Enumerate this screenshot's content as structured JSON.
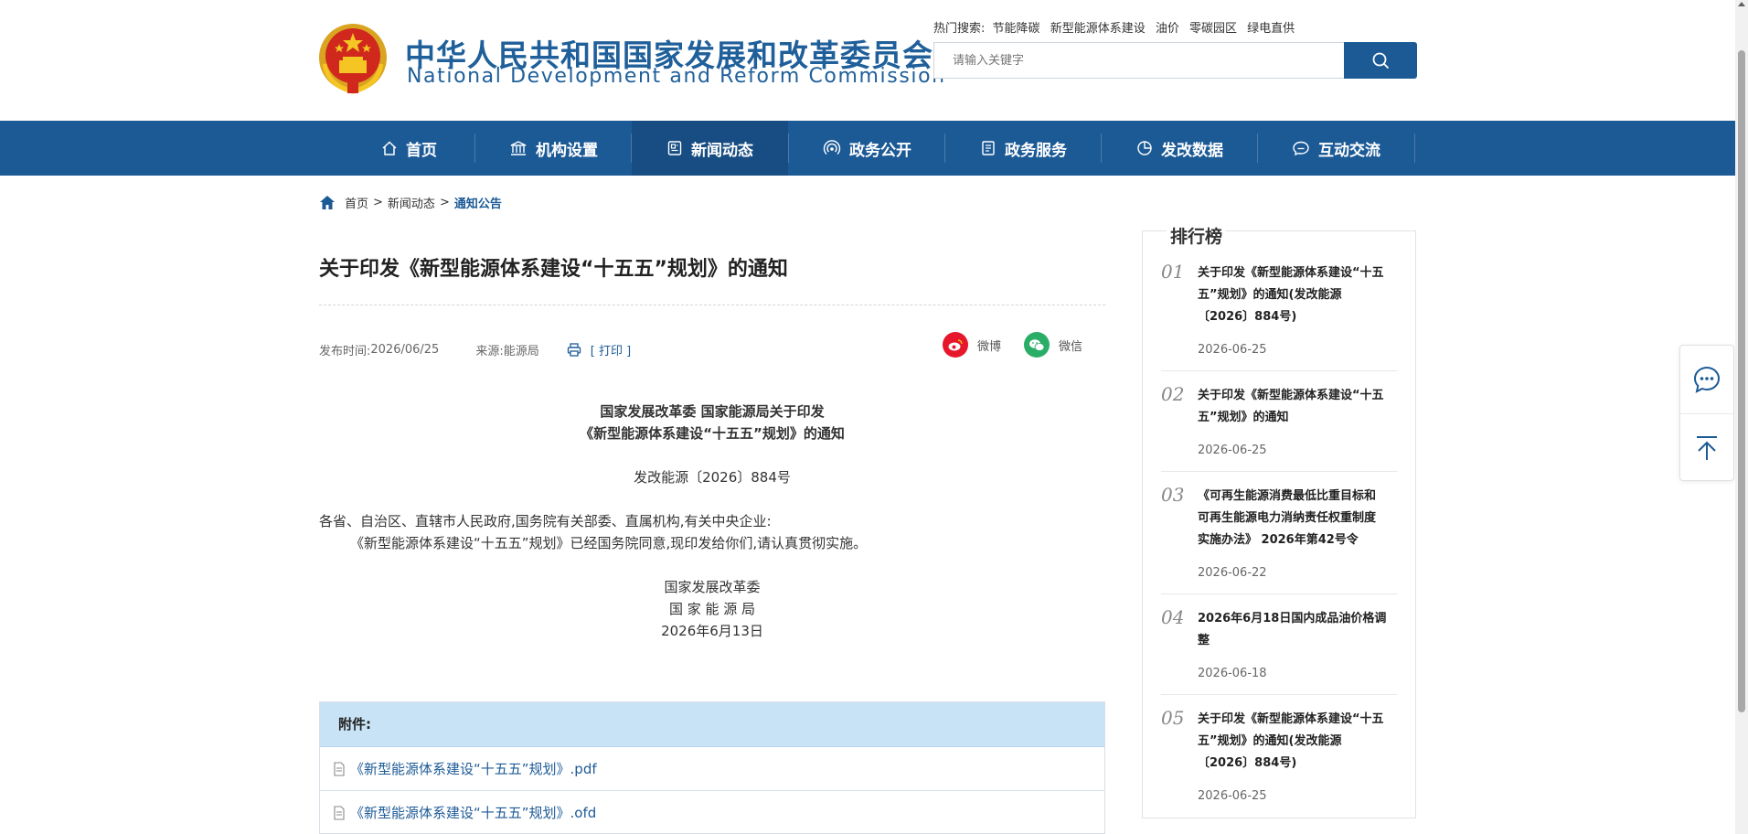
{
  "header": {
    "title_cn": "中华人民共和国国家发展和改革委员会",
    "title_en": "National Development and Reform Commission",
    "hot_label": "热门搜索:",
    "hot_terms": [
      "节能降碳",
      "新型能源体系建设",
      "油价",
      "零碳园区",
      "绿电直供"
    ],
    "search_placeholder": "请输入关键字"
  },
  "nav": {
    "items": [
      {
        "label": "首页",
        "icon": "home-icon"
      },
      {
        "label": "机构设置",
        "icon": "building-icon"
      },
      {
        "label": "新闻动态",
        "icon": "news-icon"
      },
      {
        "label": "政务公开",
        "icon": "broadcast-icon"
      },
      {
        "label": "政务服务",
        "icon": "document-icon"
      },
      {
        "label": "发改数据",
        "icon": "pie-chart-icon"
      },
      {
        "label": "互动交流",
        "icon": "chat-icon"
      }
    ],
    "active_index": 2
  },
  "breadcrumb": {
    "items": [
      "首页",
      "新闻动态",
      "通知公告"
    ],
    "separator": ">"
  },
  "article": {
    "title": "关于印发《新型能源体系建设“十五五”规划》的通知",
    "publish_label": "发布时间:",
    "publish_date": "2026/06/25",
    "source_label": "来源:",
    "source": "能源局",
    "print_label": "[ 打印 ]",
    "share": {
      "weibo": "微博",
      "wechat": "微信"
    },
    "heading_line1": "国家发展改革委 国家能源局关于印发",
    "heading_line2": "《新型能源体系建设“十五五”规划》的通知",
    "doc_number": "发改能源〔2026〕884号",
    "salutation": "各省、自治区、直辖市人民政府,国务院有关部委、直属机构,有关中央企业:",
    "paragraph": "《新型能源体系建设“十五五”规划》已经国务院同意,现印发给你们,请认真贯彻实施。",
    "signer1": "国家发展改革委",
    "signer2": "国 家 能 源 局",
    "sign_date": "2026年6月13日"
  },
  "attachments": {
    "header": "附件:",
    "files": [
      "《新型能源体系建设“十五五”规划》.pdf",
      "《新型能源体系建设“十五五”规划》.ofd"
    ]
  },
  "ranking": {
    "title": "排行榜",
    "items": [
      {
        "num": "01",
        "lines": [
          "关于印发《新型能源体系建设“十五",
          "五”规划》的通知(发改能源",
          "〔2026〕884号)"
        ],
        "date": "2026-06-25"
      },
      {
        "num": "02",
        "lines": [
          "关于印发《新型能源体系建设“十五",
          "五”规划》的通知"
        ],
        "date": "2026-06-25"
      },
      {
        "num": "03",
        "lines": [
          "《可再生能源消费最低比重目标和",
          "可再生能源电力消纳责任权重制度",
          "实施办法》 2026年第42号令"
        ],
        "date": "2026-06-22"
      },
      {
        "num": "04",
        "lines": [
          "2026年6月18日国内成品油价格调",
          "整"
        ],
        "date": "2026-06-18"
      },
      {
        "num": "05",
        "lines": [
          "关于印发《新型能源体系建设“十五",
          "五”规划》的通知(发改能源",
          "〔2026〕884号)"
        ],
        "date": "2026-06-25"
      }
    ]
  },
  "colors": {
    "brand_blue": "#1c5a96",
    "nav_active": "#174d82",
    "attach_header": "#c9e3f6",
    "weibo_red": "#e6162d",
    "wechat_green": "#2aae67"
  }
}
